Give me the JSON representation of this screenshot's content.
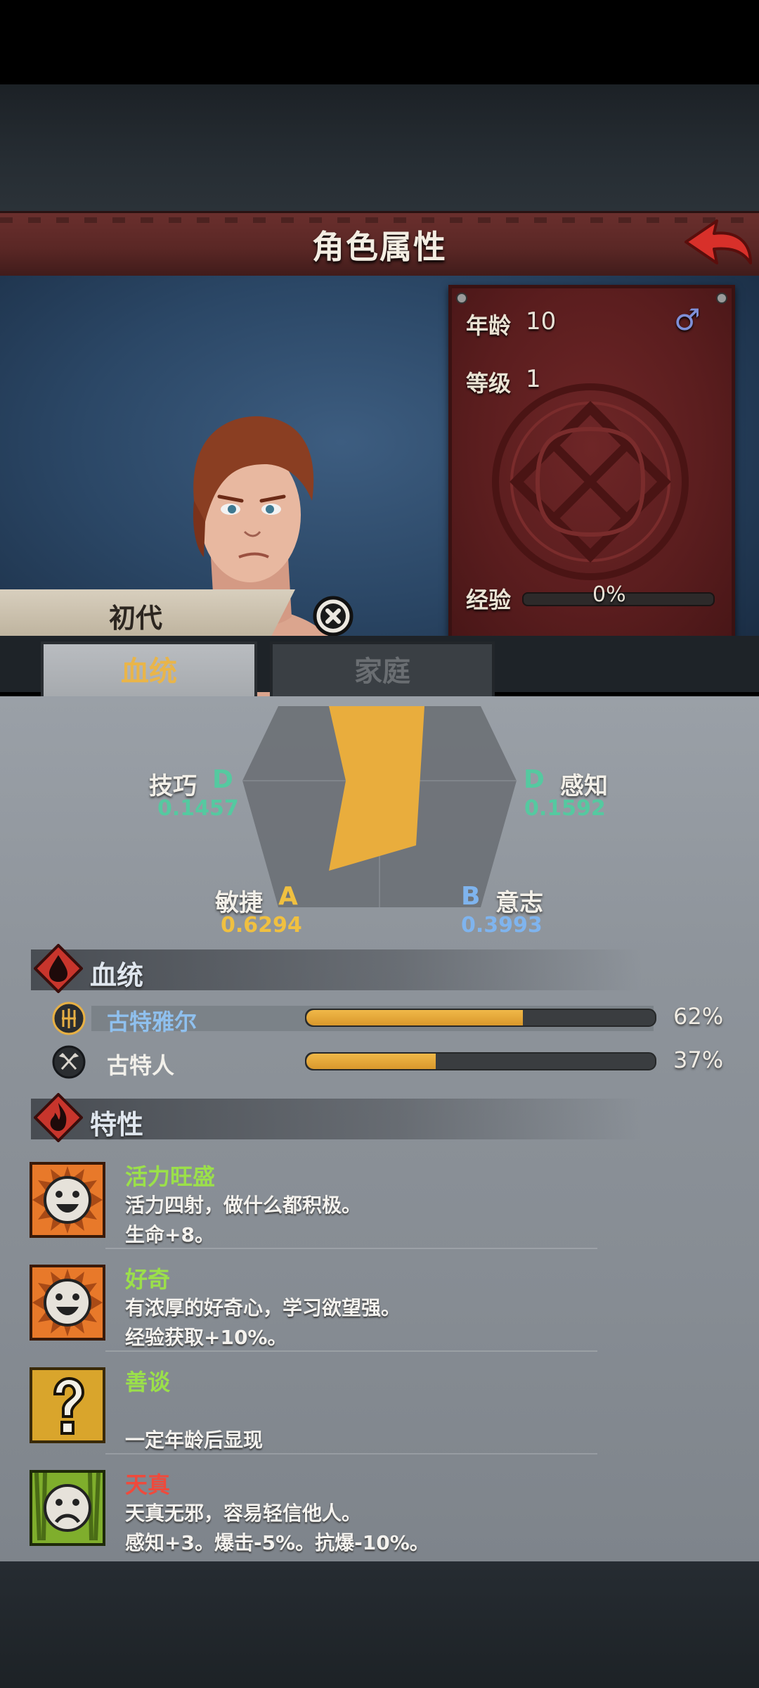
{
  "header": {
    "title": "角色属性"
  },
  "stats": {
    "age_label": "年龄",
    "age_value": "10",
    "gender_symbol": "♂",
    "level_label": "等级",
    "level_value": "1",
    "exp_label": "经验",
    "exp_value": "0%"
  },
  "character": {
    "generation": "初代"
  },
  "tabs": [
    {
      "label": "血统"
    },
    {
      "label": "家庭"
    }
  ],
  "attributes": [
    {
      "name": "技巧",
      "grade": "D",
      "value": "0.1457"
    },
    {
      "name": "感知",
      "grade": "D",
      "value": "0.1592"
    },
    {
      "name": "敏捷",
      "grade": "A",
      "value": "0.6294"
    },
    {
      "name": "意志",
      "grade": "B",
      "value": "0.3993"
    }
  ],
  "bloodline": {
    "title": "血统",
    "items": [
      {
        "name": "古特雅尔",
        "percent": "62%",
        "fraction": 0.62,
        "color": "#8fc0ee"
      },
      {
        "name": "古特人",
        "percent": "37%",
        "fraction": 0.37,
        "color": "#f2f0ea"
      }
    ]
  },
  "traits": {
    "title": "特性",
    "items": [
      {
        "name": "活力旺盛",
        "desc": "活力四射，做什么都积极。",
        "effect": "生命+8。",
        "name_color": "#9be04a",
        "icon": "happy-face-icon"
      },
      {
        "name": "好奇",
        "desc": "有浓厚的好奇心，学习欲望强。",
        "effect": "经验获取+10%。",
        "name_color": "#9be04a",
        "icon": "happy-face-icon"
      },
      {
        "name": "善谈",
        "desc": "",
        "effect": "一定年龄后显现",
        "name_color": "#9be04a",
        "icon": "question-mark-icon"
      },
      {
        "name": "天真",
        "desc": "天真无邪，容易轻信他人。",
        "effect": "感知+3。爆击-5%。抗爆-10%。",
        "name_color": "#ef4a3c",
        "icon": "sad-face-icon"
      }
    ]
  },
  "colors": {
    "grade_d": "#55c9a0",
    "grade_a": "#f0c040",
    "grade_b": "#7fb4ee",
    "radar_fill": "#e9ad3d"
  }
}
